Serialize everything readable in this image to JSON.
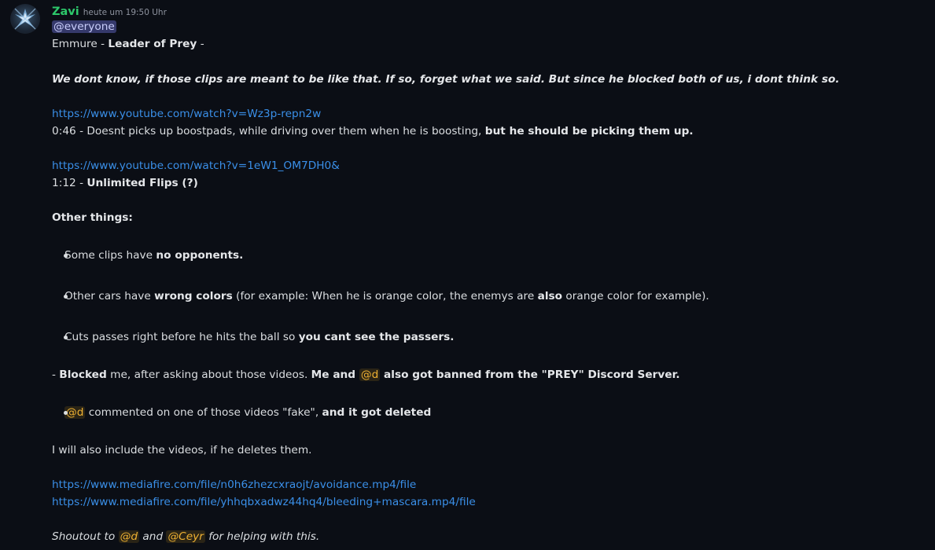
{
  "author": {
    "username": "Zavi",
    "timestamp": "heute um 19:50 Uhr",
    "username_color": "#2dc86b"
  },
  "mention_everyone": "@everyone",
  "title_line": {
    "prefix": "Emmure - ",
    "bold": "Leader of Prey",
    "suffix": " -"
  },
  "intro": "We dont know, if those clips are meant to be like that. If so, forget what we said. But since he blocked both of us, i dont think so.",
  "link1": "https://www.youtube.com/watch?v=Wz3p-repn2w",
  "note1": {
    "text": "0:46 - Doesnt picks up boostpads, while driving over them when he is boosting, ",
    "bold": "but he should be picking them up."
  },
  "link2": "https://www.youtube.com/watch?v=1eW1_OM7DH0&",
  "note2": {
    "text": "1:12 - ",
    "bold": "Unlimited Flips (?)"
  },
  "other_heading": "Other things:",
  "bullets": [
    {
      "text": "Some clips have ",
      "bold": "no opponents."
    },
    {
      "text": "Other cars have ",
      "bold": "wrong colors",
      "rest": " (for example: When he is orange color, the enemys are ",
      "bold2": "also",
      "rest2": " orange color for example)."
    },
    {
      "text": "Cuts passes right before he hits the ball so ",
      "bold": "you cant see the passers."
    }
  ],
  "blocked_line": {
    "dash": "- ",
    "bold1": "Blocked",
    "text": " me, after asking about those videos. ",
    "bold2": "Me and ",
    "mention": "@d",
    "bold3": " also got banned from the \"PREY\" Discord Server."
  },
  "deleted_bullet": {
    "mention": "@d",
    "text": " commented on one of those videos \"fake\", ",
    "bold": "and it got deleted"
  },
  "include_line": "I will also include the videos, if he deletes them.",
  "link3": "https://www.mediafire.com/file/n0h6zhezcxraojt/avoidance.mp4/file",
  "link4": "https://www.mediafire.com/file/yhhqbxadwz44hq4/bleeding+mascara.mp4/file",
  "shoutout": {
    "prefix": "Shoutout to ",
    "mention1": "@d",
    "mid": " and ",
    "mention2": "@Ceyr",
    "suffix": " for helping with this."
  }
}
